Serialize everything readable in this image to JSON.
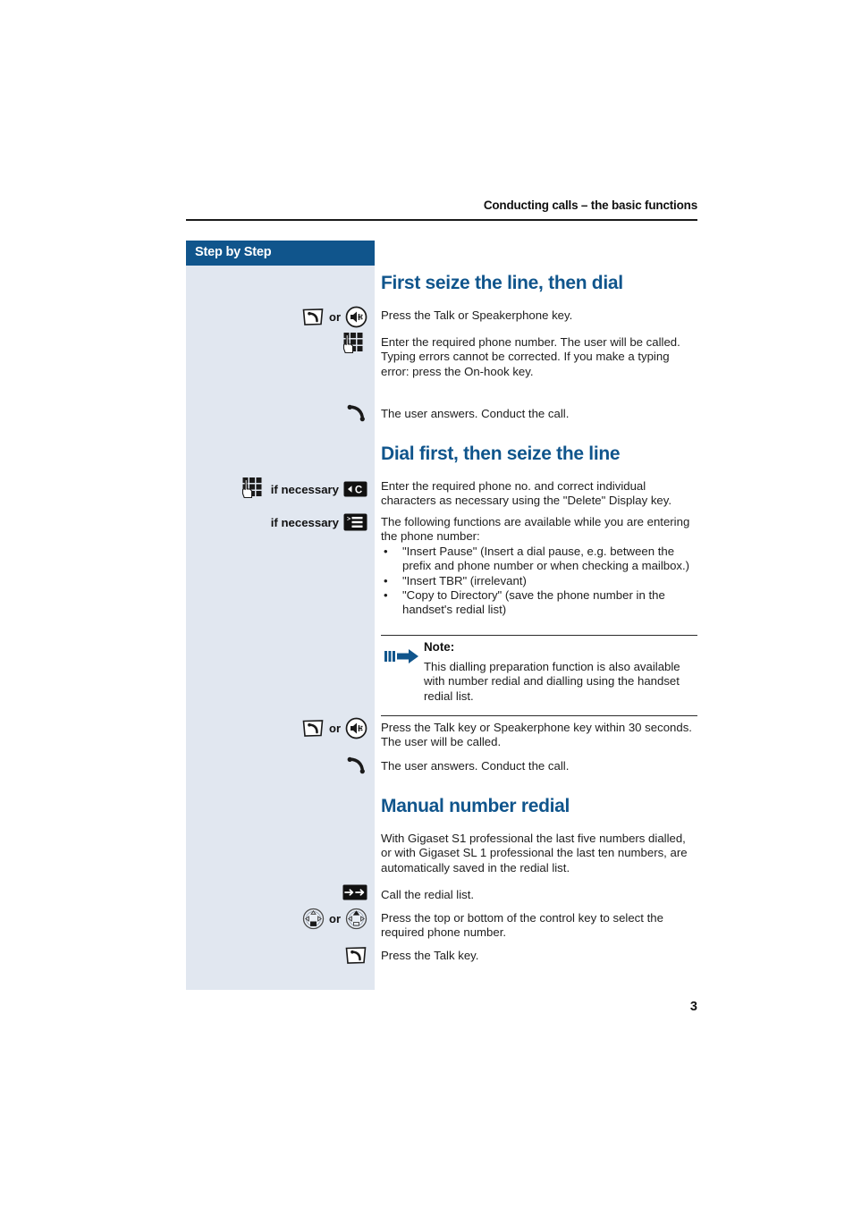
{
  "document": {
    "running_header": "Conducting calls – the basic functions",
    "page_number": "3",
    "colors": {
      "accent_blue": "#10558c",
      "sidebar_bg": "#e1e7f0",
      "text": "#1d1d1d"
    }
  },
  "sidebar": {
    "title": "Step by Step"
  },
  "sections": [
    {
      "id": "first-seize",
      "heading": "First seize the line, then dial",
      "rows": [
        {
          "icons": [
            "talk-key-icon",
            "speakerphone-key-icon"
          ],
          "connector": "or",
          "label": "",
          "text": "Press the Talk or Speakerphone key."
        },
        {
          "icons": [
            "keypad-icon"
          ],
          "label": "",
          "text": "Enter the required phone number. The user will be called.\nTyping errors cannot be corrected. If you make a typing error: press the On-hook key."
        },
        {
          "icons": [
            "handset-icon"
          ],
          "label": "",
          "text": "The user answers. Conduct the call."
        }
      ]
    },
    {
      "id": "dial-first",
      "heading": "Dial first, then seize the line",
      "rows": [
        {
          "icons": [
            "keypad-icon",
            "delete-display-key-icon"
          ],
          "label": "if necessary",
          "text": "Enter the required phone no. and correct individual characters as necessary using the \"Delete\" Display key."
        },
        {
          "icons": [
            "menu-display-key-icon"
          ],
          "label": "if necessary",
          "text": "The following functions are available while you are entering the phone number:"
        }
      ],
      "bullets": [
        "\"Insert Pause\" (Insert a dial pause, e.g.  between the prefix and phone number or when checking a mailbox.)",
        "\"Insert TBR\" (irrelevant)",
        "\"Copy to Directory\" (save the phone number in the handset's redial list)"
      ],
      "note": {
        "icon": "note-arrow-icon",
        "title": "Note:",
        "text": "This dialling preparation function is also available with number redial and dialling using the handset redial list."
      },
      "rows_after_note": [
        {
          "icons": [
            "talk-key-icon",
            "speakerphone-key-icon"
          ],
          "connector": "or",
          "label": "",
          "text": "Press the Talk key or Speakerphone key within 30 seconds. The user will be called."
        },
        {
          "icons": [
            "handset-icon"
          ],
          "label": "",
          "text": "The user answers. Conduct the call."
        }
      ]
    },
    {
      "id": "manual-redial",
      "heading": "Manual number redial",
      "intro": "With Gigaset S1 professional the last five numbers dialled, or with Gigaset SL 1 professional the last ten numbers, are automatically saved in the redial list.",
      "rows": [
        {
          "icons": [
            "redial-key-icon"
          ],
          "label": "",
          "text": "Call the redial list."
        },
        {
          "icons": [
            "control-key-down-icon",
            "control-key-up-icon"
          ],
          "connector": "or",
          "label": "",
          "text": "Press the top or bottom of the control key to select the required phone number."
        },
        {
          "icons": [
            "talk-key-icon"
          ],
          "label": "",
          "text": "Press the Talk key."
        }
      ]
    }
  ],
  "bullet_glyph": "•",
  "connector_or": "or"
}
